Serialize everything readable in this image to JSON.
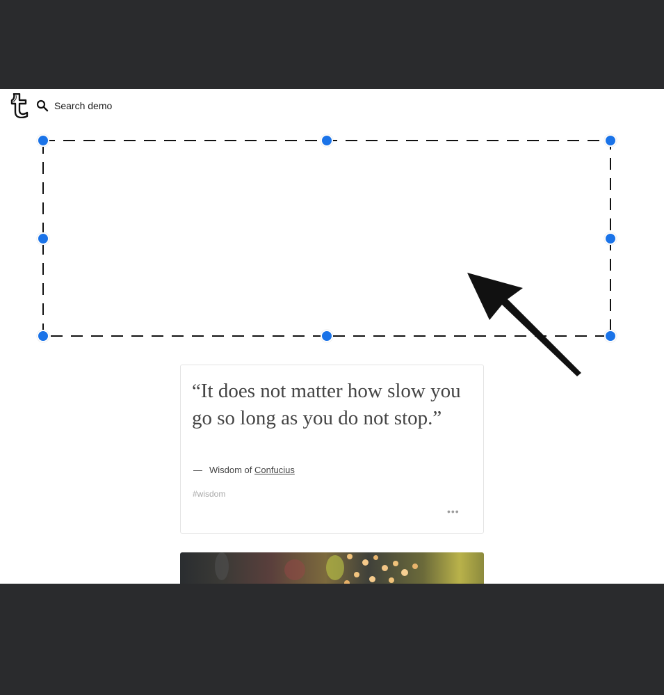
{
  "header": {
    "logo_icon": "tumblr-logo-icon",
    "search_icon": "search-icon",
    "search_label": "Search demo"
  },
  "selection_overlay": {
    "handle_color": "#1a73e8",
    "border_style": "dashed",
    "pointer_icon": "arrow-pointer-icon"
  },
  "post_quote": {
    "quote": "“It does not matter how slow you go so long as you do not stop.”",
    "dash": "—",
    "source_prefix": "Wisdom of",
    "source_link": "Confucius",
    "tag": "#wisdom",
    "more_label": "•••"
  },
  "post_photo": {
    "image": "photo-post-image"
  },
  "colors": {
    "backdrop": "#2a2b2d",
    "page_background": "#ffffff",
    "text": "#444444",
    "tag": "#a8a8a8"
  }
}
